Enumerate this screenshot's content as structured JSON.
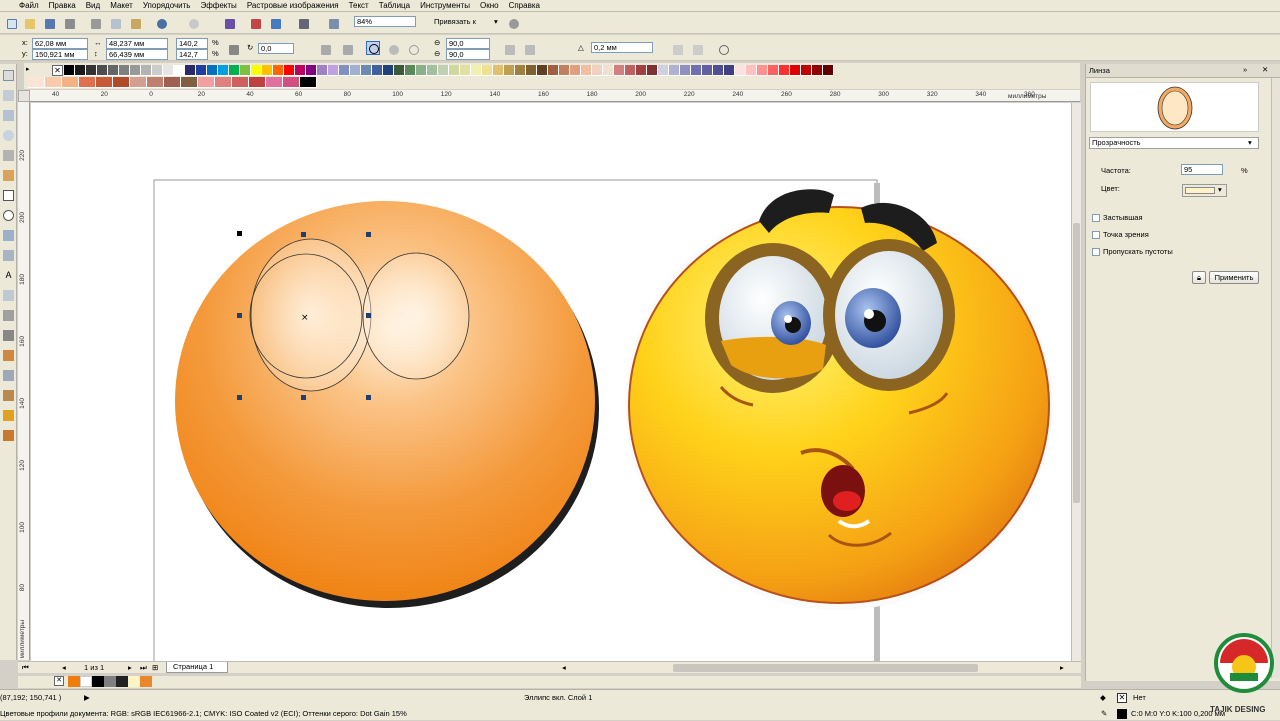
{
  "menu": [
    "Файл",
    "Правка",
    "Вид",
    "Макет",
    "Упорядочить",
    "Эффекты",
    "Растровые изображения",
    "Текст",
    "Таблица",
    "Инструменты",
    "Окно",
    "Справка"
  ],
  "toolbar_std": {
    "zoom_value": "84%",
    "snap_label": "Привязать к"
  },
  "property_bar": {
    "x_label": "x:",
    "x_value": "62,08 мм",
    "y_label": "y:",
    "y_value": "150,921 мм",
    "w_value": "48,237 мм",
    "h_value": "66,439 мм",
    "scale_w": "140,2",
    "scale_h": "142,7",
    "pct": "%",
    "angle_value": "0,0",
    "start_angle": "90,0",
    "end_angle": "90,0",
    "outline_width": "0,2 мм"
  },
  "ruler_h_labels": [
    "40",
    "20",
    "0",
    "20",
    "40",
    "60",
    "80",
    "100",
    "120",
    "140",
    "160",
    "180",
    "200",
    "220",
    "240",
    "260",
    "280",
    "300",
    "320",
    "340",
    "360"
  ],
  "ruler_h_unit": "миллиметры",
  "ruler_v_labels": [
    "220",
    "200",
    "180",
    "160",
    "140",
    "120",
    "100",
    "80"
  ],
  "ruler_v_unit": "миллиметры",
  "docker": {
    "title": "Линза",
    "lens_type": "Прозрачность",
    "rate_label": "Частота:",
    "rate_value": "95",
    "rate_unit": "%",
    "color_label": "Цвет:",
    "frozen_label": "Застывшая",
    "viewpoint_label": "Точка зрения",
    "remove_face_label": "Пропускать пустоты",
    "apply_label": "Применить",
    "lens_color": "#fef3c8"
  },
  "page_nav": {
    "page_count": "1 из 1",
    "page_tab": "Страница 1"
  },
  "status": {
    "coords": "(87,192; 150,741 )",
    "object_info": "Эллипс вкл. Слой 1",
    "color_profiles": "Цветовые профили документа: RGB: sRGB IEC61966-2.1; CMYK: ISO Coated v2 (ECI); Оттенки серого: Dot Gain 15%",
    "fill_label": "Нет",
    "outline_info": "C:0 M:0 Y:0 K:100  0,200 мм"
  },
  "watermark": "TAJIK DESING",
  "colors": {
    "orange_main": "#f28a1a",
    "orange_light": "#ffe5c2",
    "shadow": "#1e1e1e",
    "smiley_yellow": "#ffd21a"
  }
}
